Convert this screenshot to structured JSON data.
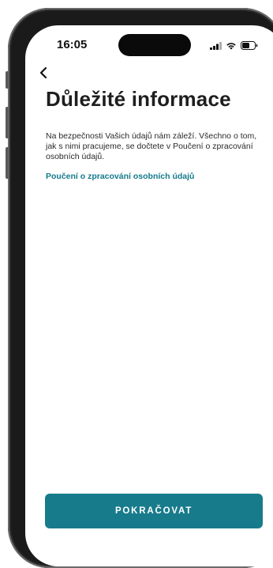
{
  "status_bar": {
    "time": "16:05",
    "icons": [
      "cellular-signal-icon",
      "wifi-icon",
      "battery-icon"
    ]
  },
  "nav": {
    "back_icon": "chevron-left-icon"
  },
  "page": {
    "title": "Důležité informace",
    "body": "Na bezpečnosti Vašich údajů nám záleží. Všechno o tom, jak s nimi pracujeme, se dočtete v Poučení o zpracování osobních údajů.",
    "link_label": "Poučení o zpracování osobních údajů"
  },
  "actions": {
    "continue_label": "POKRAČOVAT"
  },
  "colors": {
    "accent": "#187b8c",
    "link": "#147a8c",
    "text": "#1e1e1e",
    "frame": "#1a1a1a"
  }
}
